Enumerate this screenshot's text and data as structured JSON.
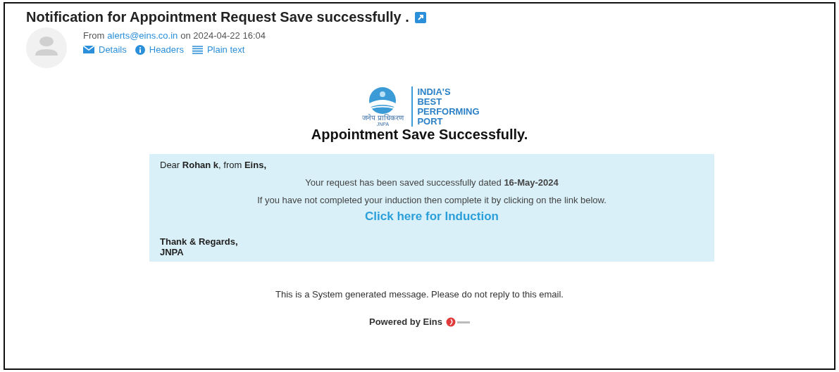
{
  "subject": "Notification for Appointment Request Save successfully .",
  "sender": {
    "prefix": "From",
    "address": "alerts@eins.co.in",
    "date": "on 2024-04-22 16:04"
  },
  "actions": [
    {
      "kind": "mail",
      "label": "Details"
    },
    {
      "kind": "info",
      "label": "Headers"
    },
    {
      "kind": "lines",
      "label": "Plain text"
    }
  ],
  "logo": {
    "hindi": "जनेप प्राधिकरण",
    "abbr": "JNPA",
    "tagline": [
      "INDIA'S",
      "BEST",
      "PERFORMING",
      "PORT"
    ]
  },
  "heading": "Appointment Save Successfully.",
  "message": {
    "greeting": "Dear **Rohan k**, from **Eins,**",
    "line_1": "Your request has been saved successfully dated **16-May-2024**",
    "line_2": "If you have not completed your induction then complete it by clicking on the link below.",
    "link": "Click here for Induction",
    "closing": "Thank & Regards,",
    "signature": "JNPA"
  },
  "footer": {
    "notice": "This is a System generated message. Please do not reply to this email.",
    "powered_by": "Powered by Eins"
  }
}
